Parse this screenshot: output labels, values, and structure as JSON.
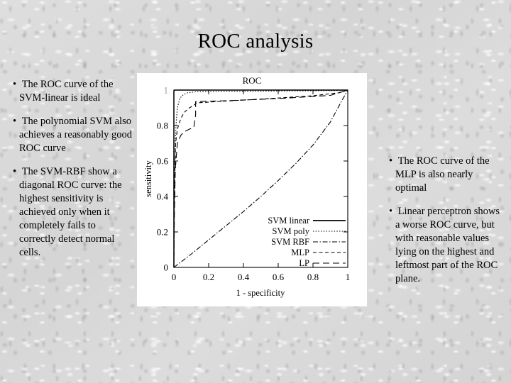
{
  "slide": {
    "title": "ROC analysis",
    "background_color": "#d8d8d8",
    "text_color": "#000000"
  },
  "left_column": {
    "bullets": [
      "The ROC curve of the SVM-linear is ideal",
      "The polynomial SVM also achieves a reasonably good ROC curve",
      "The SVM-RBF show a diagonal ROC curve: the highest sensitivity is achieved only when it completely fails to correctly detect normal cells."
    ],
    "bullet_glyph": "•"
  },
  "right_column": {
    "bullets": [
      "The ROC curve of the MLP is also nearly optimal",
      "Linear perceptron shows a worse ROC curve, but with reasonable values lying on the highest and leftmost part of the ROC plane."
    ],
    "bullet_glyph": "•"
  },
  "chart_data": {
    "type": "line",
    "title": "ROC",
    "xlabel": "1 - specificity",
    "ylabel": "sensitivity",
    "xlim": [
      0,
      1
    ],
    "ylim": [
      0,
      1
    ],
    "xticks": [
      "0",
      "0.2",
      "0.4",
      "0.6",
      "0.8",
      "1"
    ],
    "xtick_values": [
      0,
      0.2,
      0.4,
      0.6,
      0.8,
      1
    ],
    "yticks": [
      "0",
      "0.2",
      "0.4",
      "0.6",
      "0.8",
      "1"
    ],
    "ytick_values": [
      0,
      0.2,
      0.4,
      0.6,
      0.8,
      1
    ],
    "grid": false,
    "legend_position": "center-right",
    "line_color": "#000000",
    "series": [
      {
        "name": "SVM linear",
        "style": "solid",
        "x": [
          0,
          0,
          0.005,
          1
        ],
        "y": [
          0,
          0.995,
          1,
          1
        ]
      },
      {
        "name": "SVM poly",
        "style": "dotted",
        "x": [
          0,
          0,
          0.006,
          0.012,
          0.02,
          0.035,
          0.055,
          0.08,
          0.12,
          0.3,
          0.6,
          0.93,
          1
        ],
        "y": [
          0,
          0.07,
          0.62,
          0.8,
          0.9,
          0.955,
          0.975,
          0.985,
          0.99,
          0.993,
          0.995,
          0.997,
          1
        ]
      },
      {
        "name": "SVM RBF",
        "style": "dashdot",
        "x": [
          0,
          0.1,
          0.2,
          0.3,
          0.4,
          0.5,
          0.6,
          0.7,
          0.8,
          0.9,
          0.96,
          1
        ],
        "y": [
          0,
          0.075,
          0.155,
          0.235,
          0.315,
          0.4,
          0.49,
          0.585,
          0.69,
          0.82,
          0.93,
          1
        ]
      },
      {
        "name": "MLP",
        "style": "dashed-short",
        "x": [
          0,
          0.002,
          0.01,
          0.02,
          0.04,
          0.06,
          0.09,
          0.12,
          0.13,
          0.3,
          0.55,
          0.8,
          0.95,
          1
        ],
        "y": [
          0,
          0.4,
          0.7,
          0.78,
          0.84,
          0.875,
          0.9,
          0.918,
          0.928,
          0.938,
          0.952,
          0.968,
          0.985,
          1
        ]
      },
      {
        "name": "LP",
        "style": "dashed-long",
        "x": [
          0,
          0.003,
          0.008,
          0.02,
          0.04,
          0.06,
          0.09,
          0.115,
          0.125,
          0.125,
          0.3,
          0.6,
          0.9,
          1
        ],
        "y": [
          0,
          0.3,
          0.55,
          0.7,
          0.745,
          0.765,
          0.78,
          0.79,
          0.86,
          0.935,
          0.94,
          0.952,
          0.97,
          1
        ]
      }
    ]
  }
}
